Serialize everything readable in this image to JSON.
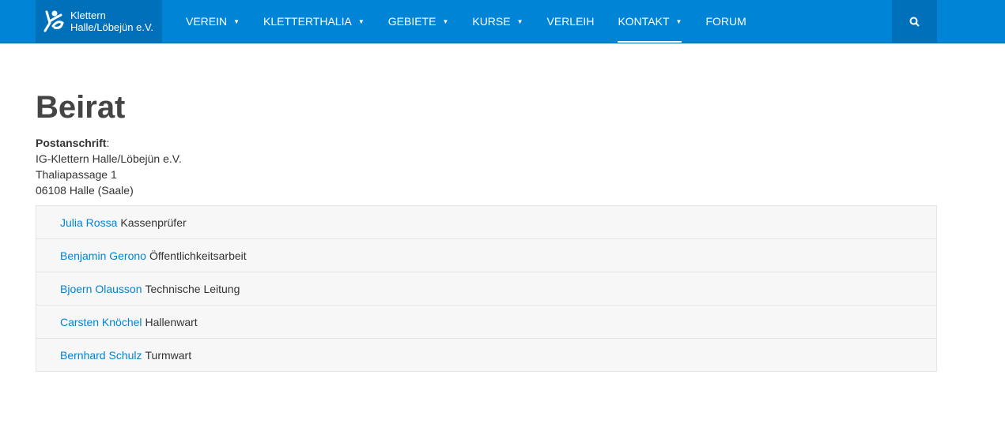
{
  "brand": {
    "line1": "Klettern",
    "line2": "Halle/Löbejün e.V."
  },
  "nav": [
    {
      "label": "VEREIN",
      "caret": true
    },
    {
      "label": "KLETTERTHALIA",
      "caret": true
    },
    {
      "label": "GEBIETE",
      "caret": true
    },
    {
      "label": "KURSE",
      "caret": true
    },
    {
      "label": "VERLEIH",
      "caret": false
    },
    {
      "label": "KONTAKT",
      "caret": true,
      "active": true
    },
    {
      "label": "FORUM",
      "caret": false
    }
  ],
  "page": {
    "title": "Beirat",
    "address_label": "Postanschrift",
    "address": [
      "IG-Klettern Halle/Löbejün e.V.",
      "Thaliapassage 1",
      "06108 Halle (Saale)"
    ]
  },
  "members": [
    {
      "name": "Julia Rossa",
      "role": "Kassenprüfer"
    },
    {
      "name": "Benjamin Gerono",
      "role": "Öffentlichkeitsarbeit"
    },
    {
      "name": "Bjoern Olausson",
      "role": "Technische Leitung"
    },
    {
      "name": "Carsten Knöchel",
      "role": "Hallenwart"
    },
    {
      "name": "Bernhard Schulz",
      "role": "Turmwart"
    }
  ]
}
